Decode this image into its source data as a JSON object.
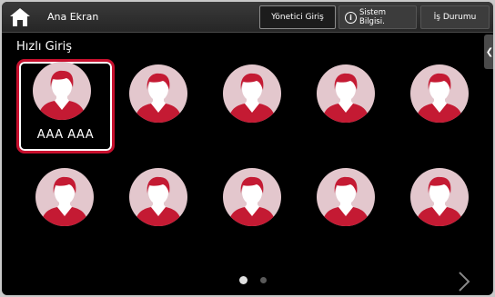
{
  "header": {
    "title": "Ana Ekran",
    "admin_login": "Yönetici Giriş",
    "system_info_line1": "Sistem",
    "system_info_line2": "Bilgisi.",
    "job_status": "İş Durumu"
  },
  "quick_login": {
    "title": "Hızlı Giriş",
    "users": [
      {
        "name": "AAA AAA",
        "selected": true
      },
      {
        "name": "",
        "selected": false
      },
      {
        "name": "",
        "selected": false
      },
      {
        "name": "",
        "selected": false
      },
      {
        "name": "",
        "selected": false
      },
      {
        "name": "",
        "selected": false
      },
      {
        "name": "",
        "selected": false
      },
      {
        "name": "",
        "selected": false
      },
      {
        "name": "",
        "selected": false
      },
      {
        "name": "",
        "selected": false
      }
    ]
  },
  "pagination": {
    "current_page": 1,
    "total_pages": 2
  },
  "colors": {
    "accent": "#c8102e",
    "avatar_bg": "#e3c7cd",
    "avatar_figure": "#c41a33"
  },
  "icons": {
    "home": "home-icon",
    "info": "info-icon",
    "side_tab": "chevron-left-icon",
    "next": "chevron-right-icon",
    "avatar": "user-avatar-icon"
  }
}
